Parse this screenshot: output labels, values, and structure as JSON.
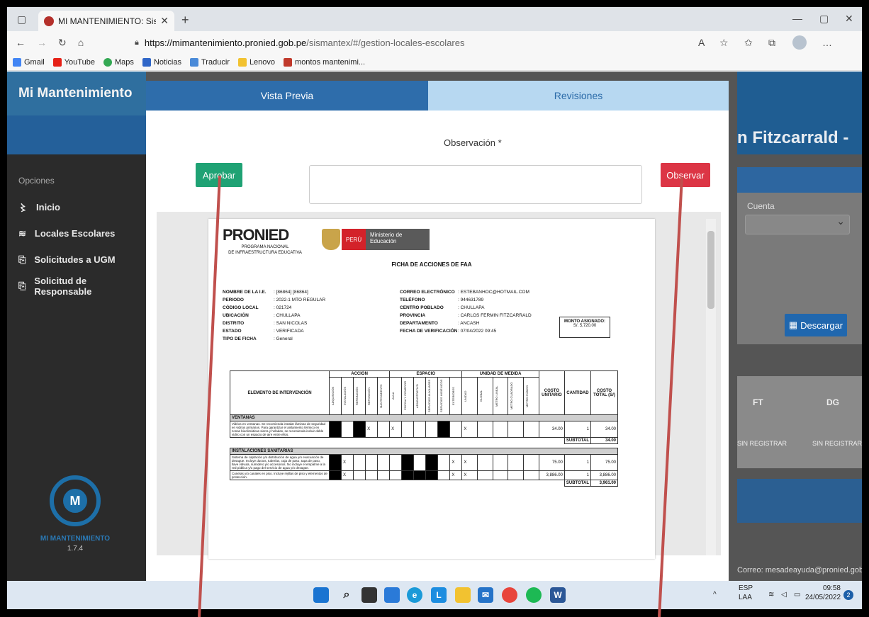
{
  "browser": {
    "tab_title": "MI MANTENIMIENTO: Sistema d",
    "url_host": "https://mimantenimiento.pronied.gob.pe",
    "url_path": "/sismantex/#/gestion-locales-escolares",
    "bookmarks": [
      "Gmail",
      "YouTube",
      "Maps",
      "Noticias",
      "Traducir",
      "Lenovo",
      "montos mantenimi..."
    ],
    "icons": [
      "tab-list-icon",
      "close-tab-icon",
      "new-tab-icon",
      "back-icon",
      "forward-icon",
      "refresh-icon",
      "home-icon",
      "lock-icon",
      "read-aloud-icon",
      "favorite-icon",
      "favorites-icon",
      "collections-icon",
      "profile-icon",
      "more-icon"
    ]
  },
  "sidebar": {
    "brand": "Mi Mantenimiento",
    "section": "Opciones",
    "items": [
      "Inicio",
      "Locales Escolares",
      "Solicitudes a UGM",
      "Solicitud de Responsable"
    ],
    "logo_text": "MI MANTENIMIENTO",
    "version": "1.7.4"
  },
  "background": {
    "title": "n Fitzcarrald -",
    "select_label": "Cuenta",
    "download_button": "Descargar",
    "col_ft": "FT",
    "col_dg": "DG",
    "val_ft": "SIN REGISTRAR",
    "val_dg": "SIN REGISTRAR",
    "footer": "Correo: mesadeayuda@pronied.gob.pe"
  },
  "modal": {
    "tab_preview": "Vista Previa",
    "tab_revisions": "Revisiones",
    "observation_label": "Observación *",
    "approve_button": "Aprobar",
    "observe_button": "Observar"
  },
  "document": {
    "logo": "PRONIED",
    "logo_sub1": "PROGRAMA NACIONAL",
    "logo_sub2": "DE INFRAESTRUCTURA EDUCATIVA",
    "peru": "PERÚ",
    "ministerio": "Ministerio de Educación",
    "title": "FICHA DE ACCIONES DE FAA",
    "left_fields": [
      {
        "k": "NOMBRE DE LA I.E.",
        "v": ": [86864] [86864]"
      },
      {
        "k": "PERIODO",
        "v": ": 2022-1 MTO REGULAR"
      },
      {
        "k": "CÓDIGO LOCAL",
        "v": ": 021724"
      },
      {
        "k": "UBICACIÓN",
        "v": ": CHULLAPA"
      },
      {
        "k": "DISTRITO",
        "v": ": SAN NICOLAS"
      },
      {
        "k": "ESTADO",
        "v": ": VERIFICADA"
      },
      {
        "k": "TIPO DE FICHA",
        "v": ": General"
      }
    ],
    "right_fields": [
      {
        "k": "CORREO ELECTRÓNICO",
        "v": ": ESTEBANHOC@HOTMAIL.COM"
      },
      {
        "k": "TELÉFONO",
        "v": ": 944631789"
      },
      {
        "k": "CENTRO POBLADO",
        "v": ": CHULLAPA"
      },
      {
        "k": "PROVINCIA",
        "v": ": CARLOS FERMIN FITZCARRALD"
      },
      {
        "k": "DEPARTAMENTO",
        "v": ": ANCASH"
      },
      {
        "k": "FECHA DE VERIFICACIÓN",
        "v": ": 07/04/2022 09:45"
      }
    ],
    "monto_label": "MONTO ASIGNADO:",
    "monto_value": "S/. 5,720.00",
    "table": {
      "col_elemento": "ELEMENTO DE INTERVENCIÓN",
      "grp_accion": "ACCIÓN",
      "grp_espacio": "ESPACIO",
      "grp_unidad": "UNIDAD DE MEDIDA",
      "col_costo_unit": "COSTO UNITARIO",
      "col_cantidad": "CANTIDAD",
      "col_costo_total": "COSTO TOTAL (S/)",
      "accion_cols": [
        "ADQUISICIÓN",
        "INSTALACIÓN",
        "REPARACIÓN",
        "REPOSICIÓN",
        "MANTENIMIENTO"
      ],
      "espacio_cols": [
        "AULA",
        "COCINA Y COMEDOR",
        "ADMINISTRATIVO",
        "SERVICIOS AUXILIARES",
        "SERVICIOS HIGIÉNICOS",
        "EXTERIORES"
      ],
      "unidad_cols": [
        "UNIDAD",
        "GLOBAL",
        "METRO LINEAL",
        "METRO CUADRADO",
        "METRO CÚBICO"
      ],
      "sections": [
        {
          "name": "VENTANAS",
          "rows": [
            {
              "desc": "Vidrios en ventanas. Se recomienda instalar láminas de seguridad en vidrios primarios. Para garantizar el aislamiento térmico en zonas bioclimáticas sierra y heladas, se recomienda incluir doble vidrio con un espacio de aire entre ellos.",
              "unit": "34.00",
              "qty": "1",
              "total": "34.00"
            }
          ],
          "subtotal_label": "SUBTOTAL",
          "subtotal": "34.00"
        },
        {
          "name": "INSTALACIONES SANITARIAS",
          "rows": [
            {
              "desc": "Sistema de captación y/o distribución de agua y/o evacuación de desagüe. Incluye ductos, tuberías, caja de paso, tapa de paso, llave válvula, sumidero y/o accesorios. No incluye el empalme a la red pública y/o pago del servicio de agua y/o desagüe.",
              "unit": "75.00",
              "qty": "1",
              "total": "75.00"
            },
            {
              "desc": "Cunetas y/o canales en piso. Incluye rejillas de piso y elementos de protección.",
              "unit": "3,886.00",
              "qty": "1",
              "total": "3,886.00"
            }
          ],
          "subtotal_label": "SUBTOTAL",
          "subtotal": "3,961.00"
        }
      ]
    }
  },
  "taskbar": {
    "lang1": "ESP",
    "lang2": "LAA",
    "time": "09:58",
    "date": "24/05/2022",
    "notif": "2"
  }
}
